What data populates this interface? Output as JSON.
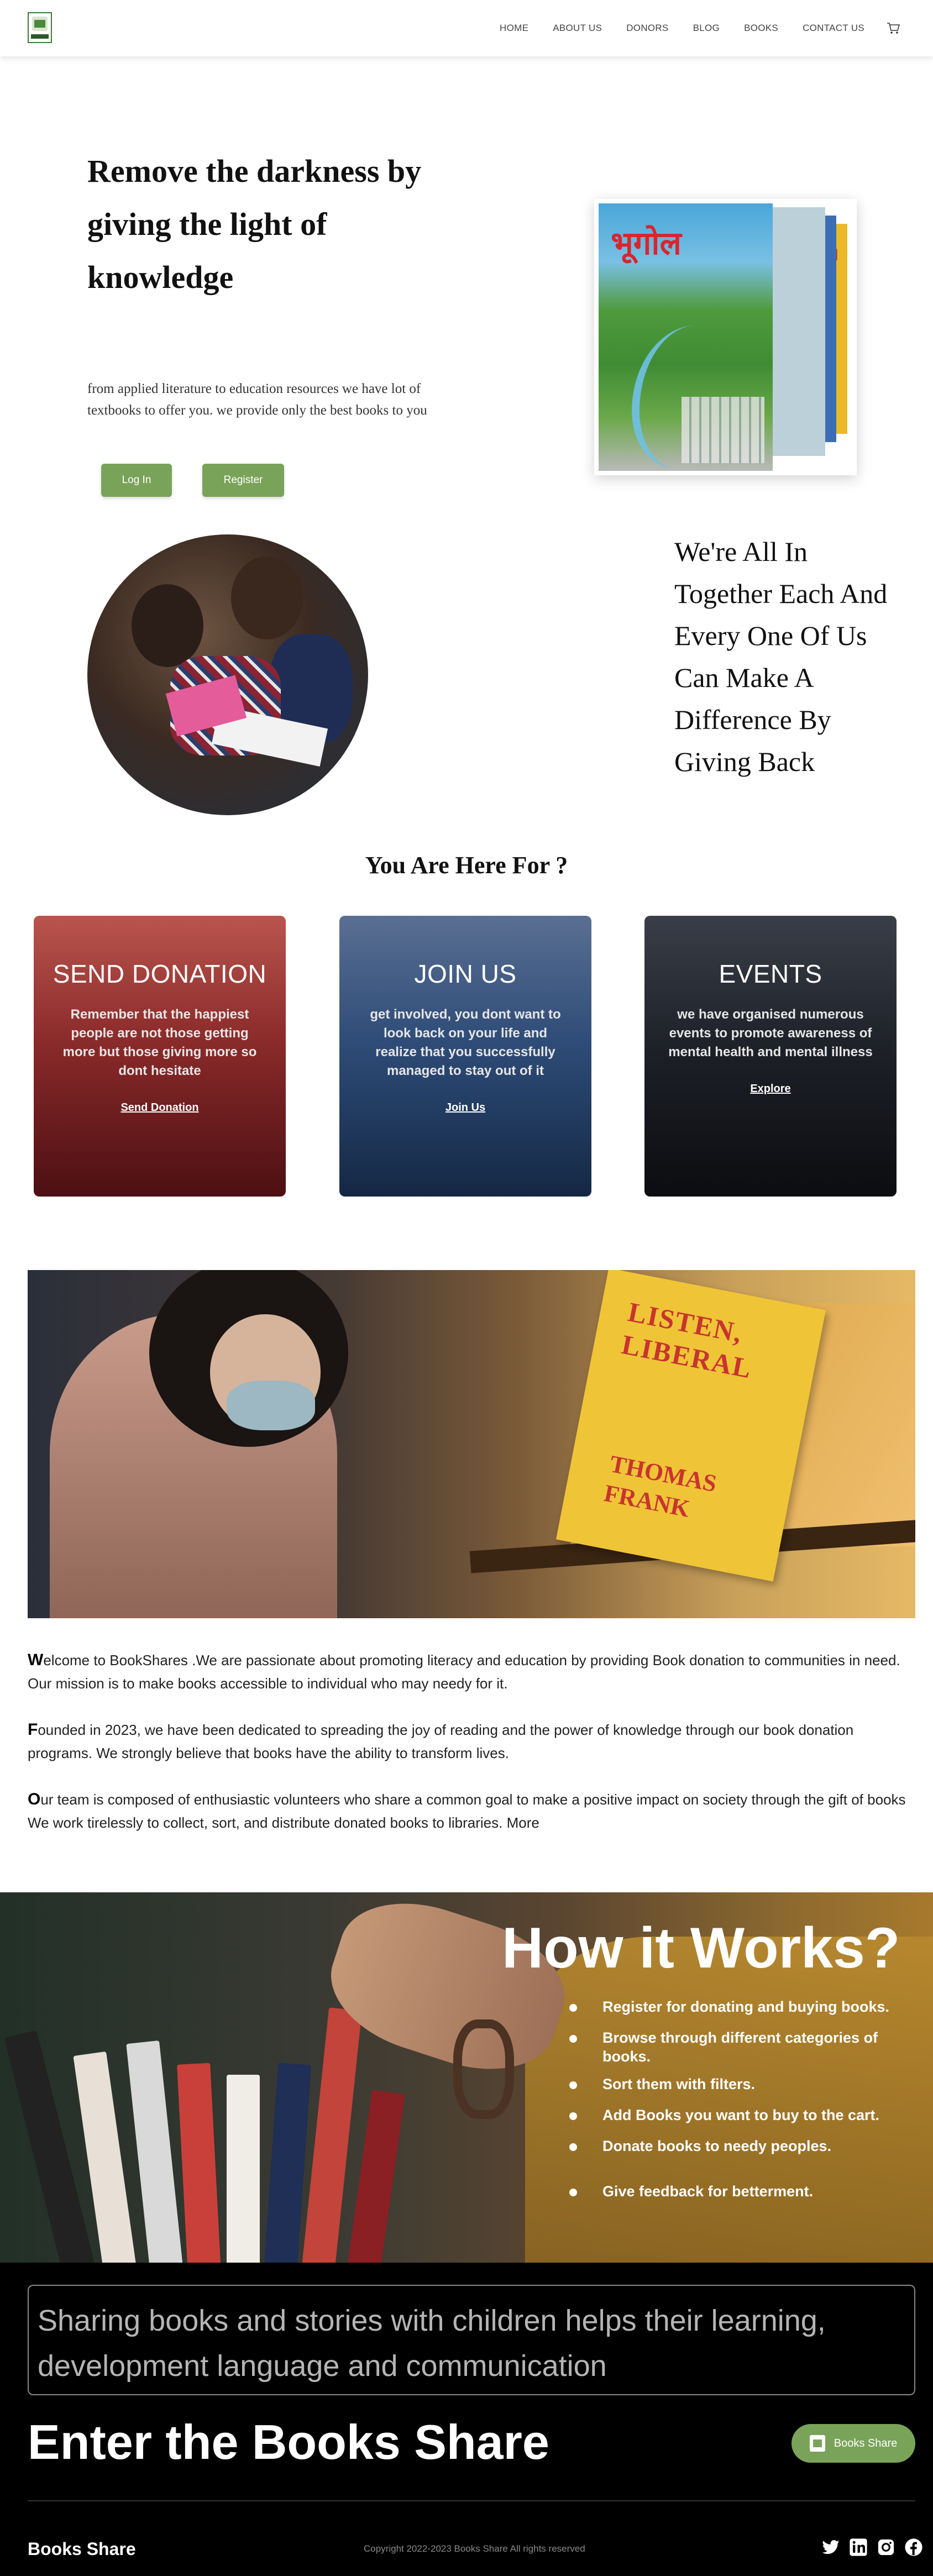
{
  "nav": {
    "items": [
      "HOME",
      "ABOUT US",
      "DONORS",
      "BLOG",
      "BOOKS",
      "CONTACT US"
    ]
  },
  "hero": {
    "title": "Remove the darkness by giving the light of knowledge",
    "subtitle": "from applied literature to education resources we have lot of textbooks to offer you. we provide only the best books to you",
    "login_label": "Log In",
    "register_label": "Register",
    "book_cover_title": "भूगोल"
  },
  "together": {
    "text": "We're All In Together Each And Every One Of Us Can Make A Difference By Giving Back"
  },
  "here_for": {
    "title": "You Are Here For ?",
    "cards": [
      {
        "title": "SEND DONATION",
        "text": "Remember that the happiest people are not those getting more but those giving more so dont hesitate",
        "link": "Send Donation"
      },
      {
        "title": "JOIN US",
        "text": "get involved, you dont want to look back on your life and realize that you successfully managed to stay out of it",
        "link": "Join Us"
      },
      {
        "title": "EVENTS",
        "text": "we have organised numerous events to promote awareness of mental health and mental illness",
        "link": "Explore"
      }
    ]
  },
  "banner": {
    "book_title": "LISTEN, LIBERAL",
    "book_author": "THOMAS FRANK"
  },
  "about": {
    "paragraphs": [
      {
        "first": "W",
        "rest": "elcome to BookShares .We are passionate about promoting literacy and education by providing Book donation to communities in need. Our mission is to make books accessible to individual who may needy for it."
      },
      {
        "first": "F",
        "rest": "ounded in 2023, we have been dedicated to spreading the joy of reading and the power of knowledge through our book donation programs. We strongly believe that books have the ability to transform lives."
      },
      {
        "first": "O",
        "rest": "ur team is composed of enthusiastic volunteers who share a common goal to make a positive impact on society through the gift of books We work tirelessly to collect, sort, and distribute donated books to libraries. More"
      }
    ]
  },
  "how": {
    "title": "How it Works?",
    "steps": [
      "Register for donating and buying books.",
      "Browse through different categories of books.",
      "Sort them with filters.",
      "Add Books you want to buy to  the cart.",
      "Donate books to needy peoples.",
      "Give feedback for betterment."
    ]
  },
  "footer": {
    "quote": "Sharing books and stories with children helps their learning, development language and communication",
    "enter_title": "Enter the Books Share",
    "enter_button": "Books Share",
    "brand": "Books Share",
    "copyright": "Copyright 2022-2023 Books Share All rights reserved"
  },
  "colors": {
    "accent_green": "#7aa35a",
    "footer_bg": "#000000"
  },
  "icons": [
    "cart-icon",
    "twitter-icon",
    "linkedin-icon",
    "instagram-icon",
    "facebook-icon"
  ]
}
